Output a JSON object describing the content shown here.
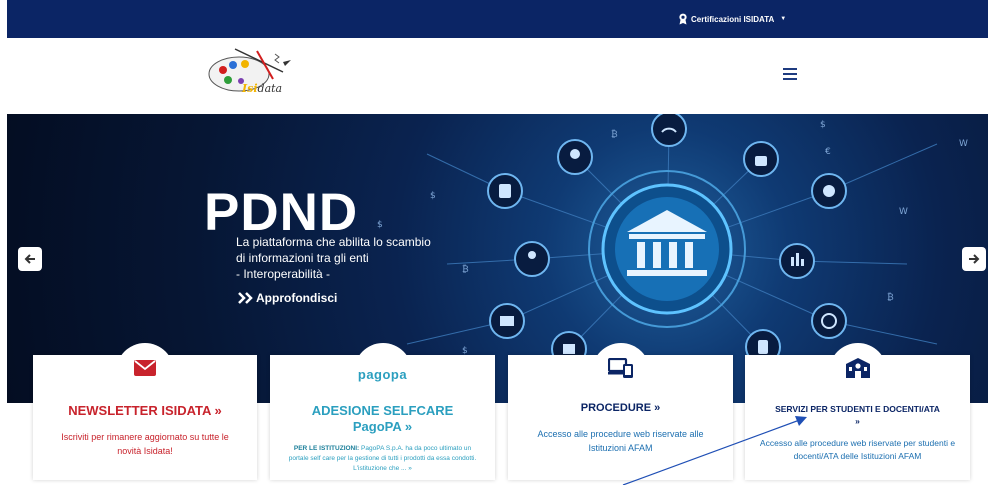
{
  "topbar": {
    "cert_label": "Certificazioni ISIDATA",
    "cert_icon": "award-icon"
  },
  "header": {
    "logo_text_is": "Isi",
    "logo_text_rest": "data",
    "menu_icon": "hamburger-icon"
  },
  "hero": {
    "headline": "PDND",
    "subtitle_line1": "La piattaforma che abilita lo scambio",
    "subtitle_line2": "di informazioni tra gli enti",
    "subtitle_line3": "- Interoperabilità -",
    "link_label": "Approfondisci",
    "prev_icon": "arrow-left-icon",
    "next_icon": "arrow-right-icon"
  },
  "cards": [
    {
      "title": "NEWSLETTER ISIDATA »",
      "desc_line1": "Iscriviti per rimanere aggiornato su tutte le",
      "desc_line2": "novità Isidata!",
      "icon": "envelope-icon"
    },
    {
      "logo": "pagopa",
      "title_line1": "ADESIONE SELFCARE",
      "title_line2": "PagoPA »",
      "desc_bold": "PER LE ISTITUZIONI:",
      "desc_line1": " PagoPA S.p.A. ha da poco ultimato un",
      "desc_line2": "portale self care per la gestione di tutti i prodotti da essa condotti.",
      "desc_line3": "L'istituzione che ... »"
    },
    {
      "title": "PROCEDURE »",
      "desc_line1": "Accesso alle procedure web riservate alle",
      "desc_line2": "Istituzioni AFAM",
      "icon": "devices-icon"
    },
    {
      "title_line1": "SERVIZI PER STUDENTI E DOCENTI/ATA",
      "title_line2": "»",
      "desc_line1": "Accesso alle procedure web riservate per studenti e",
      "desc_line2": "docenti/ATA delle Istituzioni AFAM",
      "icon": "school-icon"
    }
  ],
  "colors": {
    "navy": "#0b2565",
    "red": "#c8232c",
    "teal": "#2b9fbf",
    "blue_text": "#1c6fb0"
  }
}
